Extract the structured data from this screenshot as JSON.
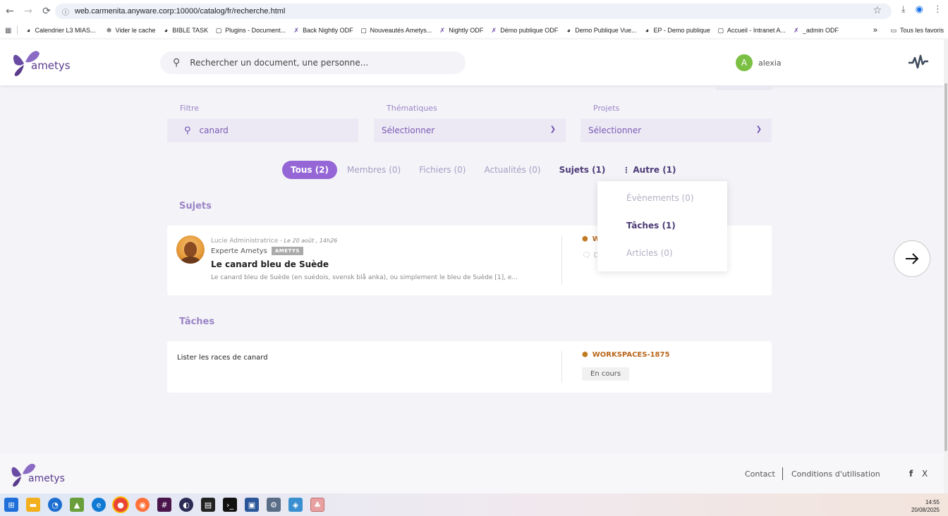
{
  "browser": {
    "url": "web.carmenita.anyware.corp:10000/catalog/fr/recherche.html",
    "bookmarks": [
      "Calendrier L3 MIAS...",
      "Vider le cache",
      "BIBLE TASK",
      "Plugins - Document...",
      "Back Nightly ODF",
      "Nouveautés Ametys...",
      "Nightly ODF",
      "Démo publique ODF",
      "Demo Publique Vue...",
      "EP - Demo publique",
      "Accueil - Intranet A...",
      "_admin ODF"
    ],
    "bookmarks_more": "»",
    "all_bookmarks": "Tous les favoris"
  },
  "header": {
    "logo_text": "ametys",
    "search_placeholder": "Rechercher un document, une personne...",
    "user_initial": "A",
    "user_name": "alexia"
  },
  "filters": {
    "filter_label": "Filtre",
    "filter_value": "canard",
    "themes_label": "Thématiques",
    "themes_value": "Sélectionner",
    "projects_label": "Projets",
    "projects_value": "Sélectionner"
  },
  "tabs": [
    {
      "label": "Tous (2)"
    },
    {
      "label": "Membres (0)"
    },
    {
      "label": "Fichiers (0)"
    },
    {
      "label": "Actualités (0)"
    },
    {
      "label": "Sujets (1)"
    },
    {
      "label": "Autre (1)"
    }
  ],
  "dropdown": [
    {
      "label": "Évènements (0)"
    },
    {
      "label": "Tâches (1)"
    },
    {
      "label": "Articles (0)"
    }
  ],
  "sujets": {
    "title": "Sujets",
    "item": {
      "author": "Lucie Administratrice",
      "date": "- Le 20 août , 14h26",
      "role": "Experte Ametys",
      "badge": "AMETYS",
      "title": "Le canard bleu de Suède",
      "excerpt": "Le  canard bleu de Suède (en  suédois, svensk blå anka), ou simplement le bleu de Suède [1], e...",
      "side_tag": "W",
      "side_comment": "D"
    }
  },
  "taches": {
    "title": "Tâches",
    "item": {
      "text": "Lister les races de canard",
      "workspace": "WORKSPACES-1875",
      "status": "En cours"
    }
  },
  "footer": {
    "logo_text": "ametys",
    "contact": "Contact",
    "conditions": "Conditions d'utilisation",
    "facebook": "f",
    "x": "X"
  },
  "taskbar": {
    "time": "14:55",
    "date": "20/08/2025"
  }
}
